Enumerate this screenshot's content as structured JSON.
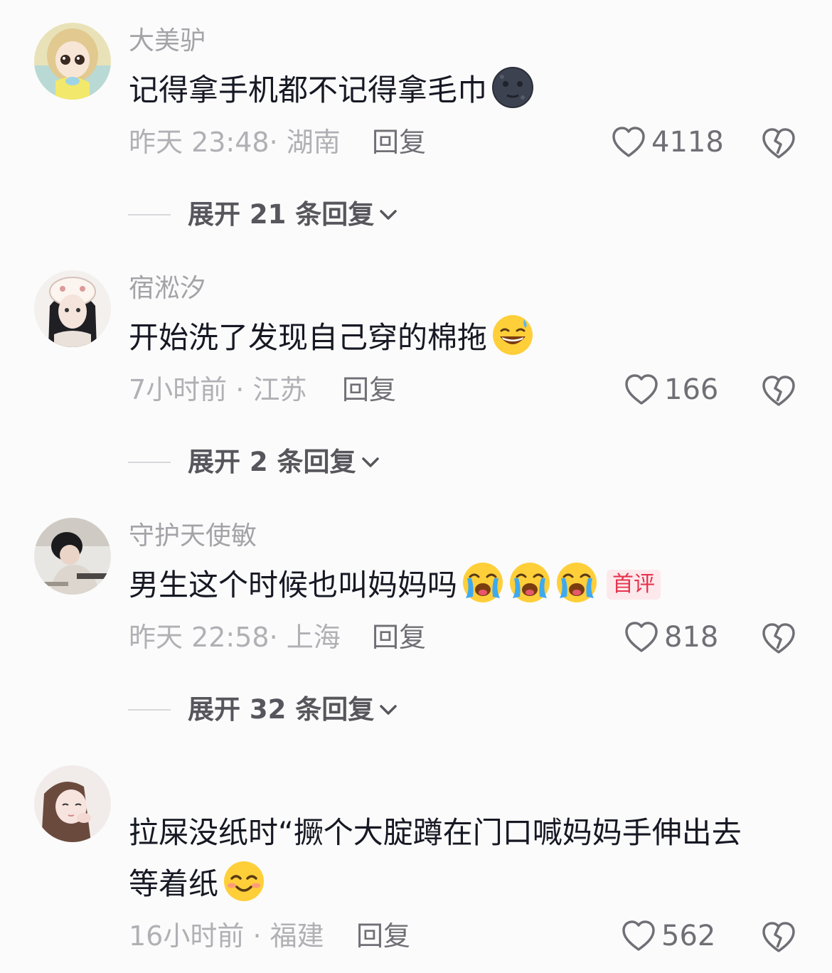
{
  "comments": [
    {
      "username": "大美驴",
      "text": "记得拿手机都不记得拿毛巾",
      "emoji": [
        "new-moon-face-icon"
      ],
      "time": "昨天 23:48",
      "location": "· 湖南",
      "reply": "回复",
      "likes": "4118",
      "expand": "展开 21 条回复"
    },
    {
      "username": "宿淞汐",
      "text": "开始洗了发现自己穿的棉拖",
      "emoji": [
        "grinning-sweat-face-icon"
      ],
      "time": "7小时前",
      "location": "· 江苏",
      "reply": "回复",
      "likes": "166",
      "expand": "展开 2 条回复"
    },
    {
      "username": "守护天使敏",
      "text": "男生这个时候也叫妈妈吗",
      "emoji": [
        "crying-face-icon",
        "crying-face-icon",
        "crying-face-icon"
      ],
      "badge": "首评",
      "time": "昨天 22:58",
      "location": "· 上海",
      "reply": "回复",
      "likes": "818",
      "expand": "展开 32 条回复"
    },
    {
      "username": "",
      "text_line1": "拉屎没纸时“撅个大腚蹲在门口喊妈妈手伸出去",
      "text_line2": "等着纸",
      "emoji": [
        "smiling-face-icon"
      ],
      "time": "16小时前",
      "location": "· 福建",
      "reply": "回复",
      "likes": "562"
    }
  ],
  "colors": {
    "text": "#161823",
    "meta": "#b0b0b5",
    "badge": "#e5344d",
    "background": "#fbfbfb"
  }
}
